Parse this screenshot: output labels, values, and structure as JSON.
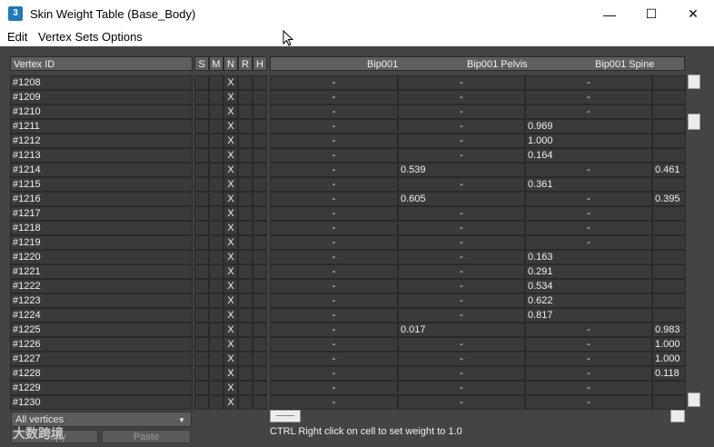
{
  "window": {
    "title": "Skin Weight Table (Base_Body)",
    "app_icon_label": "3",
    "min_symbol": "—",
    "max_symbol": "☐",
    "close_symbol": "✕"
  },
  "menu": {
    "items": [
      "Edit",
      "Vertex Sets",
      "Options"
    ]
  },
  "table": {
    "vertex_header": "Vertex ID",
    "flag_headers": [
      "S",
      "M",
      "N",
      "R",
      "H"
    ],
    "bone_headers": [
      "Bip001",
      "Bip001 Pelvis",
      "Bip001 Spine"
    ],
    "rows": [
      {
        "id": "#1208",
        "flags": [
          "",
          "",
          "X",
          "",
          ""
        ],
        "w": [
          "-",
          "-",
          "-",
          ""
        ]
      },
      {
        "id": "#1209",
        "flags": [
          "",
          "",
          "X",
          "",
          ""
        ],
        "w": [
          "-",
          "-",
          "-",
          ""
        ]
      },
      {
        "id": "#1210",
        "flags": [
          "",
          "",
          "X",
          "",
          ""
        ],
        "w": [
          "-",
          "-",
          "-",
          ""
        ]
      },
      {
        "id": "#1211",
        "flags": [
          "",
          "",
          "X",
          "",
          ""
        ],
        "w": [
          "-",
          "-",
          "0.969",
          ""
        ]
      },
      {
        "id": "#1212",
        "flags": [
          "",
          "",
          "X",
          "",
          ""
        ],
        "w": [
          "-",
          "-",
          "1.000",
          ""
        ]
      },
      {
        "id": "#1213",
        "flags": [
          "",
          "",
          "X",
          "",
          ""
        ],
        "w": [
          "-",
          "-",
          "0.164",
          ""
        ]
      },
      {
        "id": "#1214",
        "flags": [
          "",
          "",
          "X",
          "",
          ""
        ],
        "w": [
          "-",
          "0.539",
          "-",
          "0.461"
        ]
      },
      {
        "id": "#1215",
        "flags": [
          "",
          "",
          "X",
          "",
          ""
        ],
        "w": [
          "-",
          "-",
          "0.361",
          ""
        ]
      },
      {
        "id": "#1216",
        "flags": [
          "",
          "",
          "X",
          "",
          ""
        ],
        "w": [
          "-",
          "0.605",
          "-",
          "0.395"
        ]
      },
      {
        "id": "#1217",
        "flags": [
          "",
          "",
          "X",
          "",
          ""
        ],
        "w": [
          "-",
          "-",
          "-",
          ""
        ]
      },
      {
        "id": "#1218",
        "flags": [
          "",
          "",
          "X",
          "",
          ""
        ],
        "w": [
          "-",
          "-",
          "-",
          ""
        ]
      },
      {
        "id": "#1219",
        "flags": [
          "",
          "",
          "X",
          "",
          ""
        ],
        "w": [
          "-",
          "-",
          "-",
          ""
        ]
      },
      {
        "id": "#1220",
        "flags": [
          "",
          "",
          "X",
          "",
          ""
        ],
        "w": [
          "-",
          "-",
          "0.163",
          ""
        ]
      },
      {
        "id": "#1221",
        "flags": [
          "",
          "",
          "X",
          "",
          ""
        ],
        "w": [
          "-",
          "-",
          "0.291",
          ""
        ]
      },
      {
        "id": "#1222",
        "flags": [
          "",
          "",
          "X",
          "",
          ""
        ],
        "w": [
          "-",
          "-",
          "0.534",
          ""
        ]
      },
      {
        "id": "#1223",
        "flags": [
          "",
          "",
          "X",
          "",
          ""
        ],
        "w": [
          "-",
          "-",
          "0.622",
          ""
        ]
      },
      {
        "id": "#1224",
        "flags": [
          "",
          "",
          "X",
          "",
          ""
        ],
        "w": [
          "-",
          "-",
          "0.817",
          ""
        ]
      },
      {
        "id": "#1225",
        "flags": [
          "",
          "",
          "X",
          "",
          ""
        ],
        "w": [
          "-",
          "0.017",
          "-",
          "0.983"
        ]
      },
      {
        "id": "#1226",
        "flags": [
          "",
          "",
          "X",
          "",
          ""
        ],
        "w": [
          "-",
          "-",
          "-",
          "1.000"
        ]
      },
      {
        "id": "#1227",
        "flags": [
          "",
          "",
          "X",
          "",
          ""
        ],
        "w": [
          "-",
          "-",
          "-",
          "1.000"
        ]
      },
      {
        "id": "#1228",
        "flags": [
          "",
          "",
          "X",
          "",
          ""
        ],
        "w": [
          "-",
          "-",
          "-",
          "0.118"
        ]
      },
      {
        "id": "#1229",
        "flags": [
          "",
          "",
          "X",
          "",
          ""
        ],
        "w": [
          "-",
          "-",
          "-",
          ""
        ]
      },
      {
        "id": "#1230",
        "flags": [
          "",
          "",
          "X",
          "",
          ""
        ],
        "w": [
          "-",
          "-",
          "-",
          ""
        ]
      }
    ]
  },
  "footer": {
    "vertex_set": "All vertices",
    "copy_label": "Copy",
    "paste_label": "Paste",
    "status": "CTRL Right click on cell to set weight to 1.0",
    "watermark": "大数跨境"
  },
  "colors": {
    "panel_bg": "#444444",
    "cell_bg": "#3a3a3a",
    "header_bg": "#5f5f5f",
    "text": "#f0f0f0"
  }
}
